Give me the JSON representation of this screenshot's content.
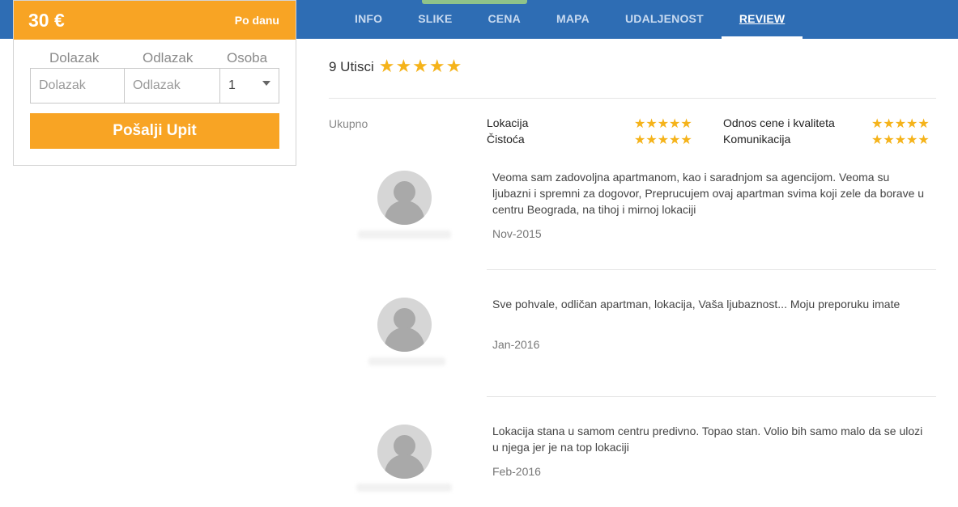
{
  "nav": {
    "items": [
      "INFO",
      "SLIKE",
      "CENA",
      "MAPA",
      "UDALJENOST",
      "REVIEW"
    ],
    "active": "REVIEW"
  },
  "booking": {
    "price": "30 €",
    "period": "Po danu",
    "labels": {
      "checkin": "Dolazak",
      "checkout": "Odlazak",
      "guests": "Osoba"
    },
    "placeholders": {
      "checkin": "Dolazak",
      "checkout": "Odlazak"
    },
    "guests_value": "1",
    "submit_label": "Pošalji Upit"
  },
  "reviews_summary": {
    "count_text": "9 Utisci",
    "stars": "★★★★★",
    "overall_label": "Ukupno",
    "categories": [
      {
        "label": "Lokacija",
        "stars": "★★★★★"
      },
      {
        "label": "Čistoća",
        "stars": "★★★★★"
      },
      {
        "label": "Odnos cene i kvaliteta",
        "stars": "★★★★★"
      },
      {
        "label": "Komunikacija",
        "stars": "★★★★★"
      }
    ]
  },
  "reviews": [
    {
      "text": "Veoma sam zadovoljna apartmanom, kao i saradnjom sa agencijom. Veoma su ljubazni i spremni za dogovor, Preprucujem ovaj apartman svima koji zele da borave u centru Beograda, na tihoj i mirnoj lokaciji",
      "date": "Nov-2015"
    },
    {
      "text": "Sve pohvale, odličan apartman, lokacija, Vaša ljubaznost... Moju preporuku imate",
      "date": "Jan-2016"
    },
    {
      "text": "Lokacija stana u samom centru predivno. Topao stan. Volio bih samo malo da se ulozi u njega jer je na top lokaciji",
      "date": "Feb-2016"
    }
  ],
  "colors": {
    "nav_bg": "#2e6db4",
    "accent_orange": "#f8a424",
    "star": "#f5b31a",
    "nav_indicator": "#8fc38a"
  }
}
